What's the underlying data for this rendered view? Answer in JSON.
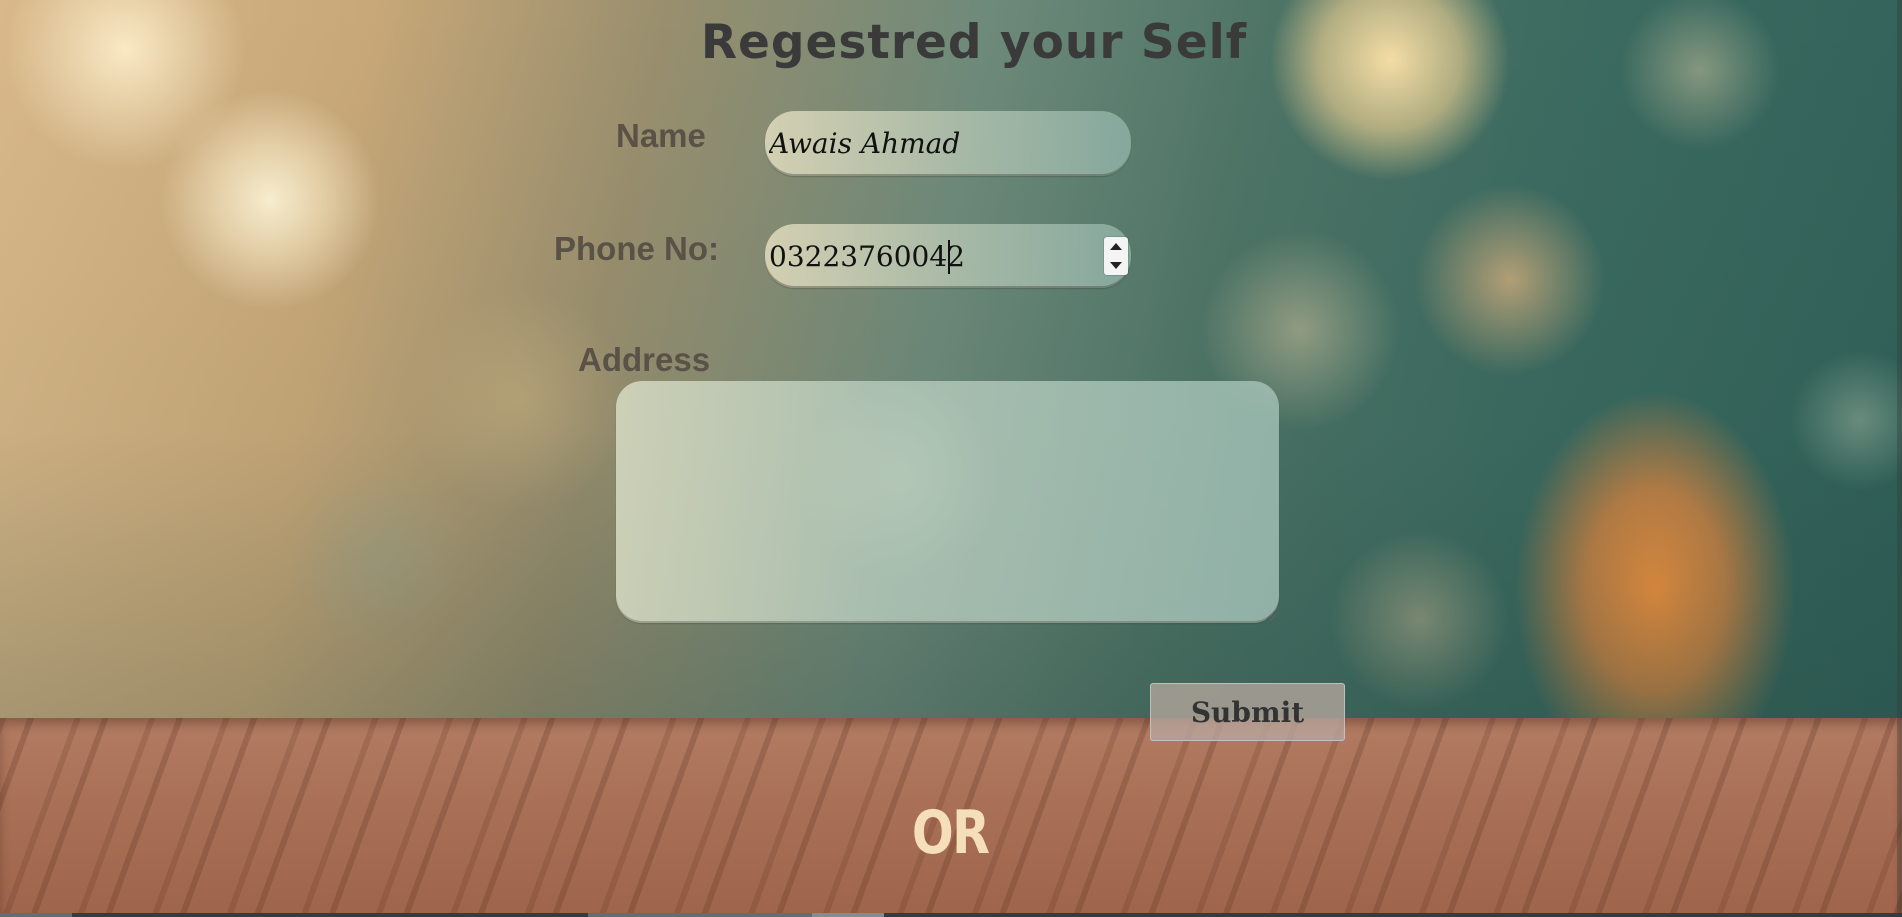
{
  "page": {
    "title": "Regestred your Self",
    "or_text": "OR"
  },
  "form": {
    "name": {
      "label": "Name",
      "value": "Awais Ahmad"
    },
    "phone": {
      "label": "Phone No:",
      "value": "03223760042"
    },
    "address": {
      "label": "Address",
      "value": ""
    },
    "submit_label": "Submit"
  },
  "colors": {
    "heading": "#3a3a3a",
    "label": "#5a5147",
    "or_text": "#f5dfb9",
    "submit_bg": "#b9aaa0"
  },
  "icons": {
    "spinner_up": "triangle-up",
    "spinner_down": "triangle-down"
  }
}
